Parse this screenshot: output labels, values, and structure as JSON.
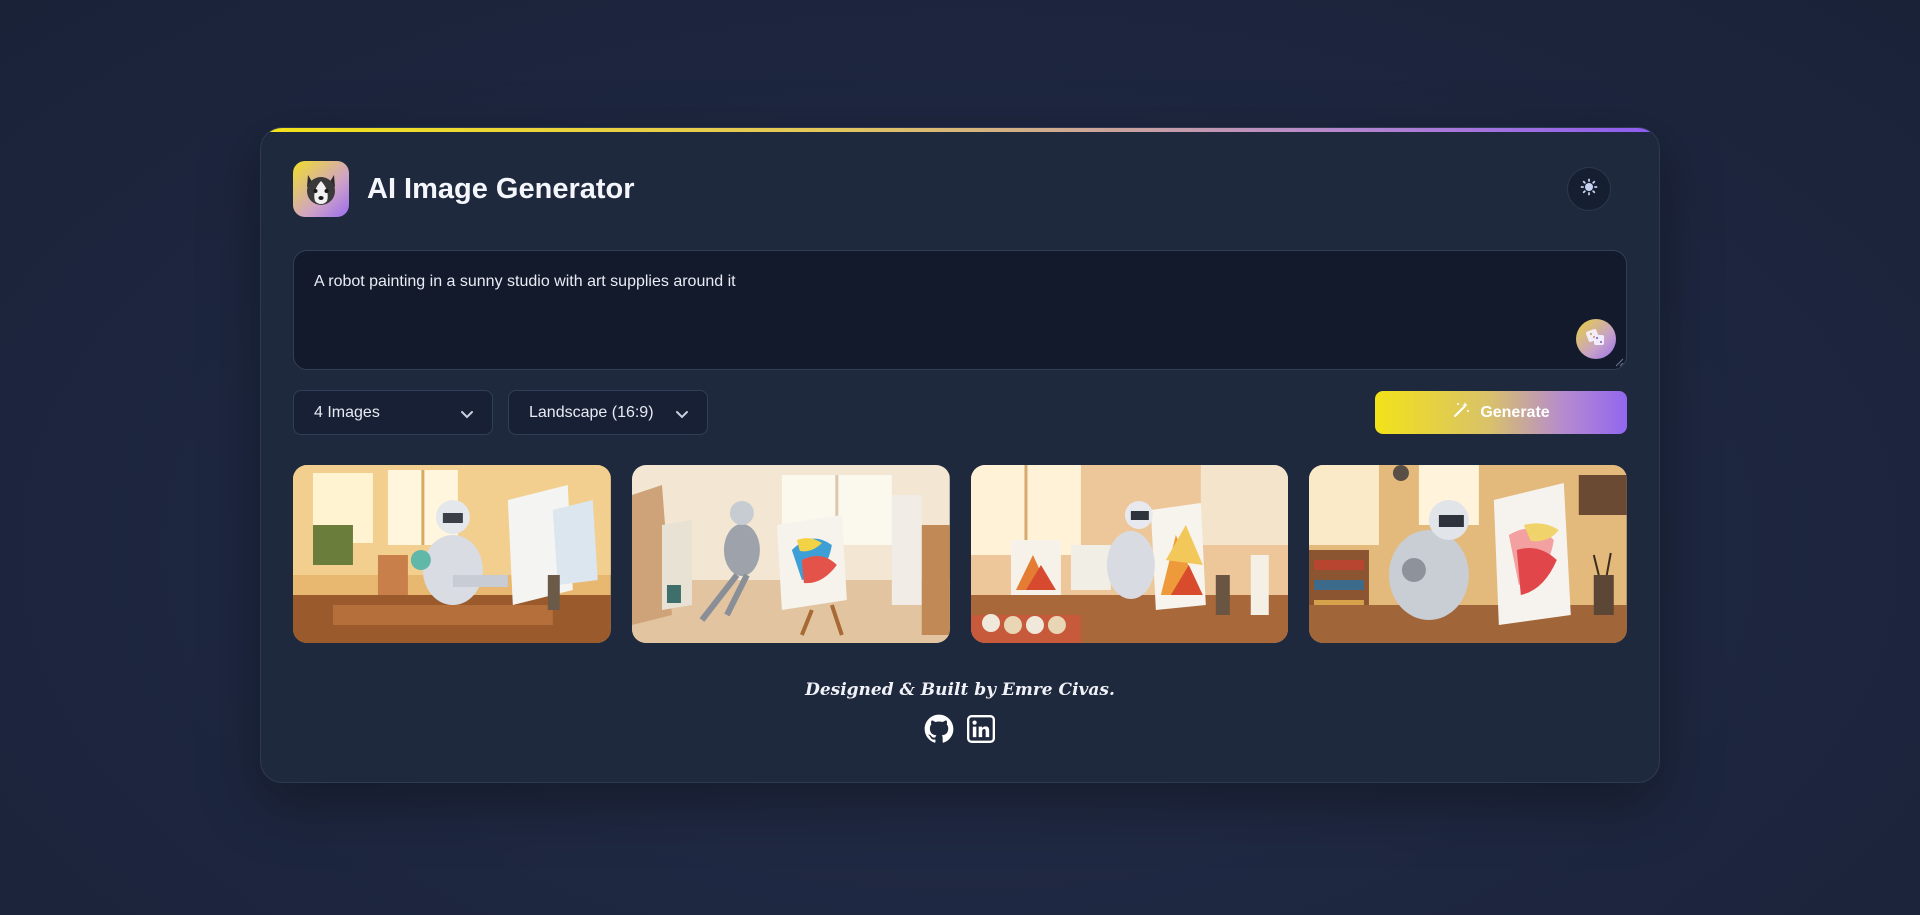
{
  "app": {
    "title": "AI Image Generator",
    "logo_icon": "husky-logo-icon",
    "theme_toggle_icon": "sun-icon"
  },
  "prompt": {
    "value": "A robot painting in a sunny studio with art supplies around it",
    "random_icon": "dice-icon"
  },
  "controls": {
    "count_select": {
      "value": "4 Images",
      "icon": "chevron-down-icon"
    },
    "ratio_select": {
      "value": "Landscape (16:9)",
      "icon": "chevron-down-icon"
    },
    "generate_button": {
      "label": "Generate",
      "icon": "magic-wand-icon"
    }
  },
  "gallery": {
    "images": [
      {
        "name": "generated-image-1"
      },
      {
        "name": "generated-image-2"
      },
      {
        "name": "generated-image-3"
      },
      {
        "name": "generated-image-4"
      }
    ]
  },
  "footer": {
    "credit": "Designed & Built by Emre Civas.",
    "links": [
      {
        "name": "github-icon"
      },
      {
        "name": "linkedin-icon"
      }
    ]
  },
  "colors": {
    "accent_start": "#f2e21a",
    "accent_end": "#8d5cf0",
    "card_bg": "#1f293d",
    "page_bg": "#1e2740"
  }
}
